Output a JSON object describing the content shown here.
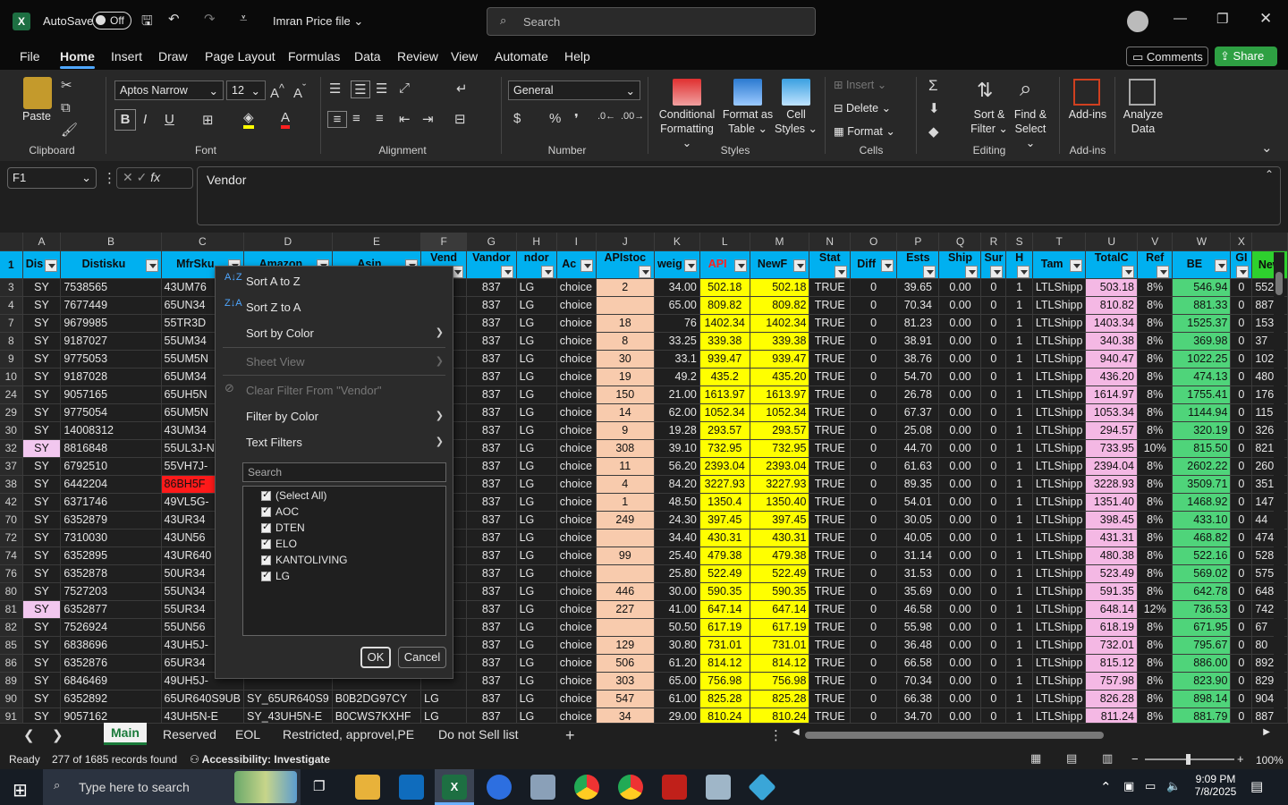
{
  "titlebar": {
    "autosave_label": "AutoSave",
    "autosave_state": "Off",
    "file_name": "Imran Price file",
    "search_placeholder": "Search"
  },
  "ribbon_tabs": [
    "File",
    "Home",
    "Insert",
    "Draw",
    "Page Layout",
    "Formulas",
    "Data",
    "Review",
    "View",
    "Automate",
    "Help"
  ],
  "ribbon_actions": {
    "comments": "Comments",
    "share": "Share"
  },
  "ribbon": {
    "paste": "Paste",
    "clipboard": "Clipboard",
    "font_name": "Aptos Narrow",
    "font_size": "12",
    "font": "Font",
    "alignment": "Alignment",
    "number_format": "General",
    "number": "Number",
    "cond_fmt1": "Conditional",
    "cond_fmt2": "Formatting",
    "fmt_table1": "Format as",
    "fmt_table2": "Table",
    "cell_styles1": "Cell",
    "cell_styles2": "Styles",
    "styles": "Styles",
    "insert": "Insert",
    "delete": "Delete",
    "format": "Format",
    "cells": "Cells",
    "sort1": "Sort &",
    "sort2": "Filter",
    "find1": "Find &",
    "find2": "Select",
    "editing": "Editing",
    "addins": "Add-ins",
    "addins_group": "Add-ins",
    "analyze1": "Analyze",
    "analyze2": "Data"
  },
  "formula_bar": {
    "name_box": "F1",
    "formula": "Vendor"
  },
  "columns": [
    "A",
    "B",
    "C",
    "D",
    "E",
    "F",
    "G",
    "H",
    "I",
    "J",
    "K",
    "L",
    "M",
    "N",
    "O",
    "P",
    "Q",
    "R",
    "S",
    "T",
    "U",
    "V",
    "W",
    "X"
  ],
  "headers": [
    "Dis",
    "Distisku",
    "MfrSku",
    "Amazon",
    "Asin",
    "Vend",
    "Vandor",
    "ndor",
    "Ac",
    "APIstoc",
    "weig",
    "API",
    "NewF",
    "Stat",
    "Diff",
    "Ests",
    "Ship",
    "Sur",
    "H",
    "Tam",
    "TotalC",
    "Ref",
    "BE",
    "GI",
    "New"
  ],
  "rows": [
    {
      "n": "3",
      "a": "SY",
      "b": "7538565",
      "c": "43UM76",
      "g": "837",
      "h": "LG",
      "i": "choice",
      "j": "2",
      "k": "34.00",
      "l": "502.18",
      "m": "502.18",
      "n2": "TRUE",
      "o": "0",
      "p": "39.65",
      "q": "0.00",
      "r": "0",
      "s": "1",
      "t": "LTLShipp",
      "u": "503.18",
      "v": "8%",
      "w": "546.94",
      "x": "0",
      "y": "552"
    },
    {
      "n": "4",
      "a": "SY",
      "b": "7677449",
      "c": "65UN34",
      "g": "837",
      "h": "LG",
      "i": "choice",
      "j": "",
      "k": "65.00",
      "l": "809.82",
      "m": "809.82",
      "n2": "TRUE",
      "o": "0",
      "p": "70.34",
      "q": "0.00",
      "r": "0",
      "s": "1",
      "t": "LTLShipp",
      "u": "810.82",
      "v": "8%",
      "w": "881.33",
      "x": "0",
      "y": "887"
    },
    {
      "n": "7",
      "a": "SY",
      "b": "9679985",
      "c": "55TR3D",
      "g": "837",
      "h": "LG",
      "i": "choice",
      "j": "18",
      "k": "76",
      "l": "1402.34",
      "m": "1402.34",
      "n2": "TRUE",
      "o": "0",
      "p": "81.23",
      "q": "0.00",
      "r": "0",
      "s": "1",
      "t": "LTLShipp",
      "u": "1403.34",
      "v": "8%",
      "w": "1525.37",
      "x": "0",
      "y": "153"
    },
    {
      "n": "8",
      "a": "SY",
      "b": "9187027",
      "c": "55UM34",
      "g": "837",
      "h": "LG",
      "i": "choice",
      "j": "8",
      "k": "33.25",
      "l": "339.38",
      "m": "339.38",
      "n2": "TRUE",
      "o": "0",
      "p": "38.91",
      "q": "0.00",
      "r": "0",
      "s": "1",
      "t": "LTLShipp",
      "u": "340.38",
      "v": "8%",
      "w": "369.98",
      "x": "0",
      "y": "37"
    },
    {
      "n": "9",
      "a": "SY",
      "b": "9775053",
      "c": "55UM5N",
      "g": "837",
      "h": "LG",
      "i": "choice",
      "j": "30",
      "k": "33.1",
      "l": "939.47",
      "m": "939.47",
      "n2": "TRUE",
      "o": "0",
      "p": "38.76",
      "q": "0.00",
      "r": "0",
      "s": "1",
      "t": "LTLShipp",
      "u": "940.47",
      "v": "8%",
      "w": "1022.25",
      "x": "0",
      "y": "102"
    },
    {
      "n": "10",
      "a": "SY",
      "b": "9187028",
      "c": "65UM34",
      "g": "837",
      "h": "LG",
      "i": "choice",
      "j": "19",
      "k": "49.2",
      "l": "435.2",
      "m": "435.20",
      "n2": "TRUE",
      "o": "0",
      "p": "54.70",
      "q": "0.00",
      "r": "0",
      "s": "1",
      "t": "LTLShipp",
      "u": "436.20",
      "v": "8%",
      "w": "474.13",
      "x": "0",
      "y": "480"
    },
    {
      "n": "24",
      "a": "SY",
      "b": "9057165",
      "c": "65UH5N",
      "g": "837",
      "h": "LG",
      "i": "choice",
      "j": "150",
      "k": "21.00",
      "l": "1613.97",
      "m": "1613.97",
      "n2": "TRUE",
      "o": "0",
      "p": "26.78",
      "q": "0.00",
      "r": "0",
      "s": "1",
      "t": "LTLShipp",
      "u": "1614.97",
      "v": "8%",
      "w": "1755.41",
      "x": "0",
      "y": "176"
    },
    {
      "n": "29",
      "a": "SY",
      "b": "9775054",
      "c": "65UM5N",
      "g": "837",
      "h": "LG",
      "i": "choice",
      "j": "14",
      "k": "62.00",
      "l": "1052.34",
      "m": "1052.34",
      "n2": "TRUE",
      "o": "0",
      "p": "67.37",
      "q": "0.00",
      "r": "0",
      "s": "1",
      "t": "LTLShipp",
      "u": "1053.34",
      "v": "8%",
      "w": "1144.94",
      "x": "0",
      "y": "115"
    },
    {
      "n": "30",
      "a": "SY",
      "b": "14008312",
      "c": "43UM34",
      "g": "837",
      "h": "LG",
      "i": "choice",
      "j": "9",
      "k": "19.28",
      "l": "293.57",
      "m": "293.57",
      "n2": "TRUE",
      "o": "0",
      "p": "25.08",
      "q": "0.00",
      "r": "0",
      "s": "1",
      "t": "LTLShipp",
      "u": "294.57",
      "v": "8%",
      "w": "320.19",
      "x": "0",
      "y": "326"
    },
    {
      "n": "32",
      "a": "SY",
      "b": "8816848",
      "c": "55UL3J-N",
      "g": "837",
      "h": "LG",
      "i": "choice",
      "j": "308",
      "k": "39.10",
      "l": "732.95",
      "m": "732.95",
      "n2": "TRUE",
      "o": "0",
      "p": "44.70",
      "q": "0.00",
      "r": "0",
      "s": "1",
      "t": "LTLShipp",
      "u": "733.95",
      "v": "10%",
      "w": "815.50",
      "x": "0",
      "y": "821",
      "apink": true
    },
    {
      "n": "37",
      "a": "SY",
      "b": "6792510",
      "c": "55VH7J-",
      "g": "837",
      "h": "LG",
      "i": "choice",
      "j": "11",
      "k": "56.20",
      "l": "2393.04",
      "m": "2393.04",
      "n2": "TRUE",
      "o": "0",
      "p": "61.63",
      "q": "0.00",
      "r": "0",
      "s": "1",
      "t": "LTLShipp",
      "u": "2394.04",
      "v": "8%",
      "w": "2602.22",
      "x": "0",
      "y": "260"
    },
    {
      "n": "38",
      "a": "SY",
      "b": "6442204",
      "c": "86BH5F",
      "g": "837",
      "h": "LG",
      "i": "choice",
      "j": "4",
      "k": "84.20",
      "l": "3227.93",
      "m": "3227.93",
      "n2": "TRUE",
      "o": "0",
      "p": "89.35",
      "q": "0.00",
      "r": "0",
      "s": "1",
      "t": "LTLShipp",
      "u": "3228.93",
      "v": "8%",
      "w": "3509.71",
      "x": "0",
      "y": "351",
      "cred": true
    },
    {
      "n": "42",
      "a": "SY",
      "b": "6371746",
      "c": "49VL5G-",
      "g": "837",
      "h": "LG",
      "i": "choice",
      "j": "1",
      "k": "48.50",
      "l": "1350.4",
      "m": "1350.40",
      "n2": "TRUE",
      "o": "0",
      "p": "54.01",
      "q": "0.00",
      "r": "0",
      "s": "1",
      "t": "LTLShipp",
      "u": "1351.40",
      "v": "8%",
      "w": "1468.92",
      "x": "0",
      "y": "147"
    },
    {
      "n": "70",
      "a": "SY",
      "b": "6352879",
      "c": "43UR34",
      "g": "837",
      "h": "LG",
      "i": "choice",
      "j": "249",
      "k": "24.30",
      "l": "397.45",
      "m": "397.45",
      "n2": "TRUE",
      "o": "0",
      "p": "30.05",
      "q": "0.00",
      "r": "0",
      "s": "1",
      "t": "LTLShipp",
      "u": "398.45",
      "v": "8%",
      "w": "433.10",
      "x": "0",
      "y": "44"
    },
    {
      "n": "72",
      "a": "SY",
      "b": "7310030",
      "c": "43UN56",
      "g": "837",
      "h": "LG",
      "i": "choice",
      "j": "",
      "k": "34.40",
      "l": "430.31",
      "m": "430.31",
      "n2": "TRUE",
      "o": "0",
      "p": "40.05",
      "q": "0.00",
      "r": "0",
      "s": "1",
      "t": "LTLShipp",
      "u": "431.31",
      "v": "8%",
      "w": "468.82",
      "x": "0",
      "y": "474"
    },
    {
      "n": "74",
      "a": "SY",
      "b": "6352895",
      "c": "43UR640",
      "g": "837",
      "h": "LG",
      "i": "choice",
      "j": "99",
      "k": "25.40",
      "l": "479.38",
      "m": "479.38",
      "n2": "TRUE",
      "o": "0",
      "p": "31.14",
      "q": "0.00",
      "r": "0",
      "s": "1",
      "t": "LTLShipp",
      "u": "480.38",
      "v": "8%",
      "w": "522.16",
      "x": "0",
      "y": "528"
    },
    {
      "n": "76",
      "a": "SY",
      "b": "6352878",
      "c": "50UR34",
      "g": "837",
      "h": "LG",
      "i": "choice",
      "j": "",
      "k": "25.80",
      "l": "522.49",
      "m": "522.49",
      "n2": "TRUE",
      "o": "0",
      "p": "31.53",
      "q": "0.00",
      "r": "0",
      "s": "1",
      "t": "LTLShipp",
      "u": "523.49",
      "v": "8%",
      "w": "569.02",
      "x": "0",
      "y": "575"
    },
    {
      "n": "80",
      "a": "SY",
      "b": "7527203",
      "c": "55UN34",
      "g": "837",
      "h": "LG",
      "i": "choice",
      "j": "446",
      "k": "30.00",
      "l": "590.35",
      "m": "590.35",
      "n2": "TRUE",
      "o": "0",
      "p": "35.69",
      "q": "0.00",
      "r": "0",
      "s": "1",
      "t": "LTLShipp",
      "u": "591.35",
      "v": "8%",
      "w": "642.78",
      "x": "0",
      "y": "648"
    },
    {
      "n": "81",
      "a": "SY",
      "b": "6352877",
      "c": "55UR34",
      "g": "837",
      "h": "LG",
      "i": "choice",
      "j": "227",
      "k": "41.00",
      "l": "647.14",
      "m": "647.14",
      "n2": "TRUE",
      "o": "0",
      "p": "46.58",
      "q": "0.00",
      "r": "0",
      "s": "1",
      "t": "LTLShipp",
      "u": "648.14",
      "v": "12%",
      "w": "736.53",
      "x": "0",
      "y": "742",
      "apink": true
    },
    {
      "n": "82",
      "a": "SY",
      "b": "7526924",
      "c": "55UN56",
      "g": "837",
      "h": "LG",
      "i": "choice",
      "j": "",
      "k": "50.50",
      "l": "617.19",
      "m": "617.19",
      "n2": "TRUE",
      "o": "0",
      "p": "55.98",
      "q": "0.00",
      "r": "0",
      "s": "1",
      "t": "LTLShipp",
      "u": "618.19",
      "v": "8%",
      "w": "671.95",
      "x": "0",
      "y": "67"
    },
    {
      "n": "85",
      "a": "SY",
      "b": "6838696",
      "c": "43UH5J-",
      "g": "837",
      "h": "LG",
      "i": "choice",
      "j": "129",
      "k": "30.80",
      "l": "731.01",
      "m": "731.01",
      "n2": "TRUE",
      "o": "0",
      "p": "36.48",
      "q": "0.00",
      "r": "0",
      "s": "1",
      "t": "LTLShipp",
      "u": "732.01",
      "v": "8%",
      "w": "795.67",
      "x": "0",
      "y": "80"
    },
    {
      "n": "86",
      "a": "SY",
      "b": "6352876",
      "c": "65UR34",
      "g": "837",
      "h": "LG",
      "i": "choice",
      "j": "506",
      "k": "61.20",
      "l": "814.12",
      "m": "814.12",
      "n2": "TRUE",
      "o": "0",
      "p": "66.58",
      "q": "0.00",
      "r": "0",
      "s": "1",
      "t": "LTLShipp",
      "u": "815.12",
      "v": "8%",
      "w": "886.00",
      "x": "0",
      "y": "892"
    },
    {
      "n": "89",
      "a": "SY",
      "b": "6846469",
      "c": "49UH5J-",
      "g": "837",
      "h": "LG",
      "i": "choice",
      "j": "303",
      "k": "65.00",
      "l": "756.98",
      "m": "756.98",
      "n2": "TRUE",
      "o": "0",
      "p": "70.34",
      "q": "0.00",
      "r": "0",
      "s": "1",
      "t": "LTLShipp",
      "u": "757.98",
      "v": "8%",
      "w": "823.90",
      "x": "0",
      "y": "829"
    },
    {
      "n": "90",
      "a": "SY",
      "b": "6352892",
      "c": "65UR640S9UB",
      "d": "SY_65UR640S9",
      "e": "B0B2DG97CY",
      "f": "LG",
      "g": "837",
      "h": "LG",
      "i": "choice",
      "j": "547",
      "k": "61.00",
      "l": "825.28",
      "m": "825.28",
      "n2": "TRUE",
      "o": "0",
      "p": "66.38",
      "q": "0.00",
      "r": "0",
      "s": "1",
      "t": "LTLShipp",
      "u": "826.28",
      "v": "8%",
      "w": "898.14",
      "x": "0",
      "y": "904"
    },
    {
      "n": "91",
      "a": "SY",
      "b": "9057162",
      "c": "43UH5N-E",
      "d": "SY_43UH5N-E",
      "e": "B0CWS7KXHF",
      "f": "LG",
      "g": "837",
      "h": "LG",
      "i": "choice",
      "j": "34",
      "k": "29.00",
      "l": "810.24",
      "m": "810.24",
      "n2": "TRUE",
      "o": "0",
      "p": "34.70",
      "q": "0.00",
      "r": "0",
      "s": "1",
      "t": "LTLShipp",
      "u": "811.24",
      "v": "8%",
      "w": "881.79",
      "x": "0",
      "y": "887"
    }
  ],
  "filter_menu": {
    "sort_az": "Sort A to Z",
    "sort_za": "Sort Z to A",
    "sort_color": "Sort by Color",
    "sheet_view": "Sheet View",
    "clear_filter": "Clear Filter From \"Vendor\"",
    "filter_color": "Filter by Color",
    "text_filters": "Text Filters",
    "search_placeholder": "Search",
    "items": [
      "(Select All)",
      "AOC",
      "DTEN",
      "ELO",
      "KANTOLIVING",
      "LG"
    ],
    "ok": "OK",
    "cancel": "Cancel"
  },
  "sheets": [
    "Main",
    "Reserved",
    "EOL",
    "Restricted, approvel,PE",
    "Do not Sell list"
  ],
  "status": {
    "ready": "Ready",
    "records": "277 of 1685 records found",
    "accessibility": "Accessibility: Investigate",
    "zoom": "100%"
  },
  "taskbar": {
    "search_placeholder": "Type here to search",
    "time": "9:09 PM",
    "date": "7/8/2025"
  },
  "colors": {
    "header_cyan": "#00b0f0",
    "salmon": "#f8cbad",
    "yellow": "#ffff00",
    "pink": "#f4b8e4",
    "green": "#4fd47a",
    "share_green": "#2ea043"
  }
}
